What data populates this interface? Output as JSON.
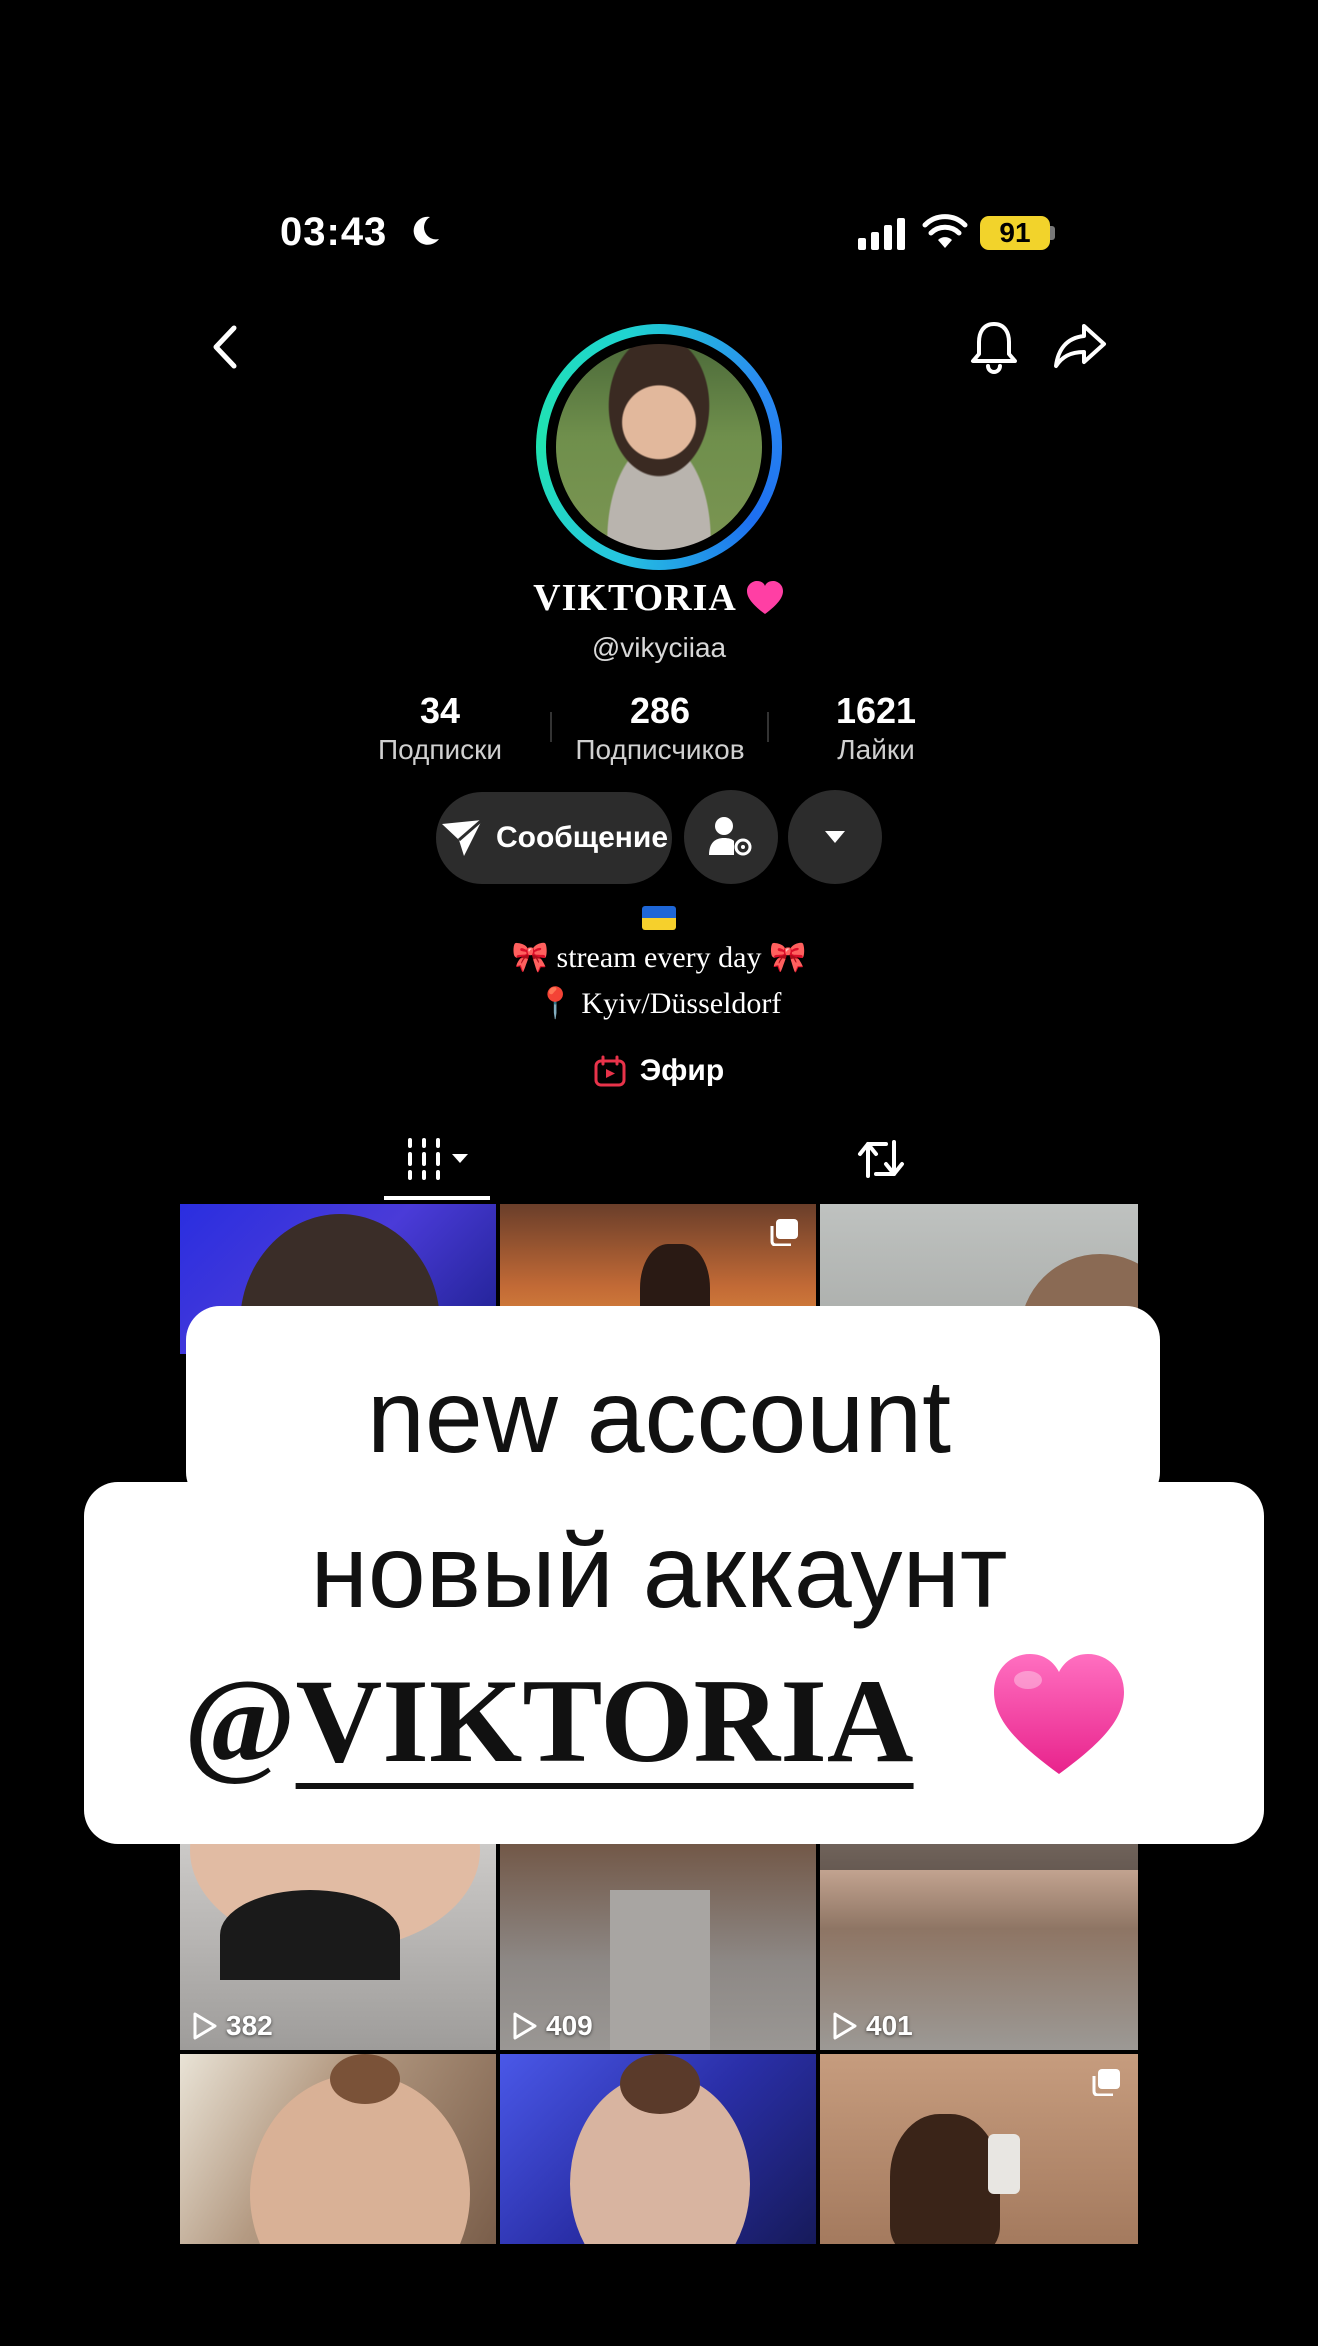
{
  "status_bar": {
    "time": "03:43",
    "battery": "91"
  },
  "profile": {
    "name": "VIKTORIA",
    "handle": "@vikyciiaa",
    "stats": [
      {
        "value": "34",
        "label": "Подписки"
      },
      {
        "value": "286",
        "label": "Подписчиков"
      },
      {
        "value": "1621",
        "label": "Лайки"
      }
    ],
    "message_button": "Сообщение",
    "bio_line1": "🎀 stream every day 🎀",
    "bio_line2": "📍 Kyiv/Düsseldorf",
    "live_label": "Эфир"
  },
  "grid": {
    "views": [
      "382",
      "409",
      "401"
    ]
  },
  "overlay": {
    "line1": "new account",
    "line2": "новый аккаунт",
    "line3_prefix": "@",
    "line3_name": "VIKTORIA"
  },
  "colors": {
    "background": "#000000",
    "button_bg": "#2c2c2c",
    "battery": "#f2d32b",
    "ring_cyan": "#20e3b0",
    "ring_blue": "#2a8cf0",
    "heart_pink": "#ff3fa4",
    "live_red": "#e8334a"
  },
  "icons": [
    "moon-icon",
    "signal-icon",
    "wifi-icon",
    "battery-icon",
    "back-icon",
    "bell-icon",
    "share-icon",
    "paper-plane-icon",
    "person-settings-icon",
    "dropdown-icon",
    "calendar-live-icon",
    "grid-tab-icon",
    "repost-icon",
    "play-icon",
    "multi-photo-icon",
    "heart-icon"
  ]
}
